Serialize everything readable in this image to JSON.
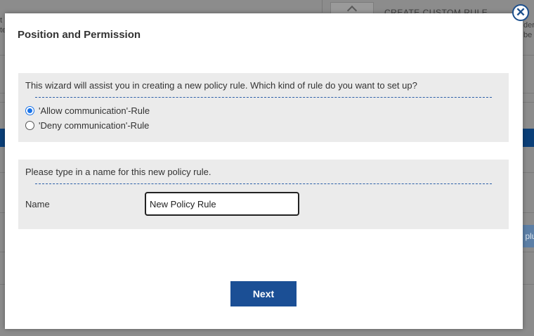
{
  "background": {
    "custom_rule_label": "CREATE CUSTOM RULE",
    "right_edge_text": "der\nbe",
    "left_edge_text": "t\nte",
    "right_button_text": "plu"
  },
  "dialog": {
    "title": "Position and Permission",
    "close_icon": "close-icon",
    "rule_type_section": {
      "prompt": "This wizard will assist you in creating a new policy rule. Which kind of rule do you want to set up?",
      "options": [
        {
          "label": "'Allow communication'-Rule",
          "selected": true
        },
        {
          "label": "'Deny communication'-Rule",
          "selected": false
        }
      ]
    },
    "name_section": {
      "prompt": "Please type in a name for this new policy rule.",
      "field_label": "Name",
      "field_value": "New Policy Rule"
    },
    "next_button": "Next"
  },
  "colors": {
    "primary": "#1b4f95",
    "panel_bg": "#ebebeb",
    "radio_accent": "#1a73e8",
    "overlay": "#8c8c8c"
  }
}
